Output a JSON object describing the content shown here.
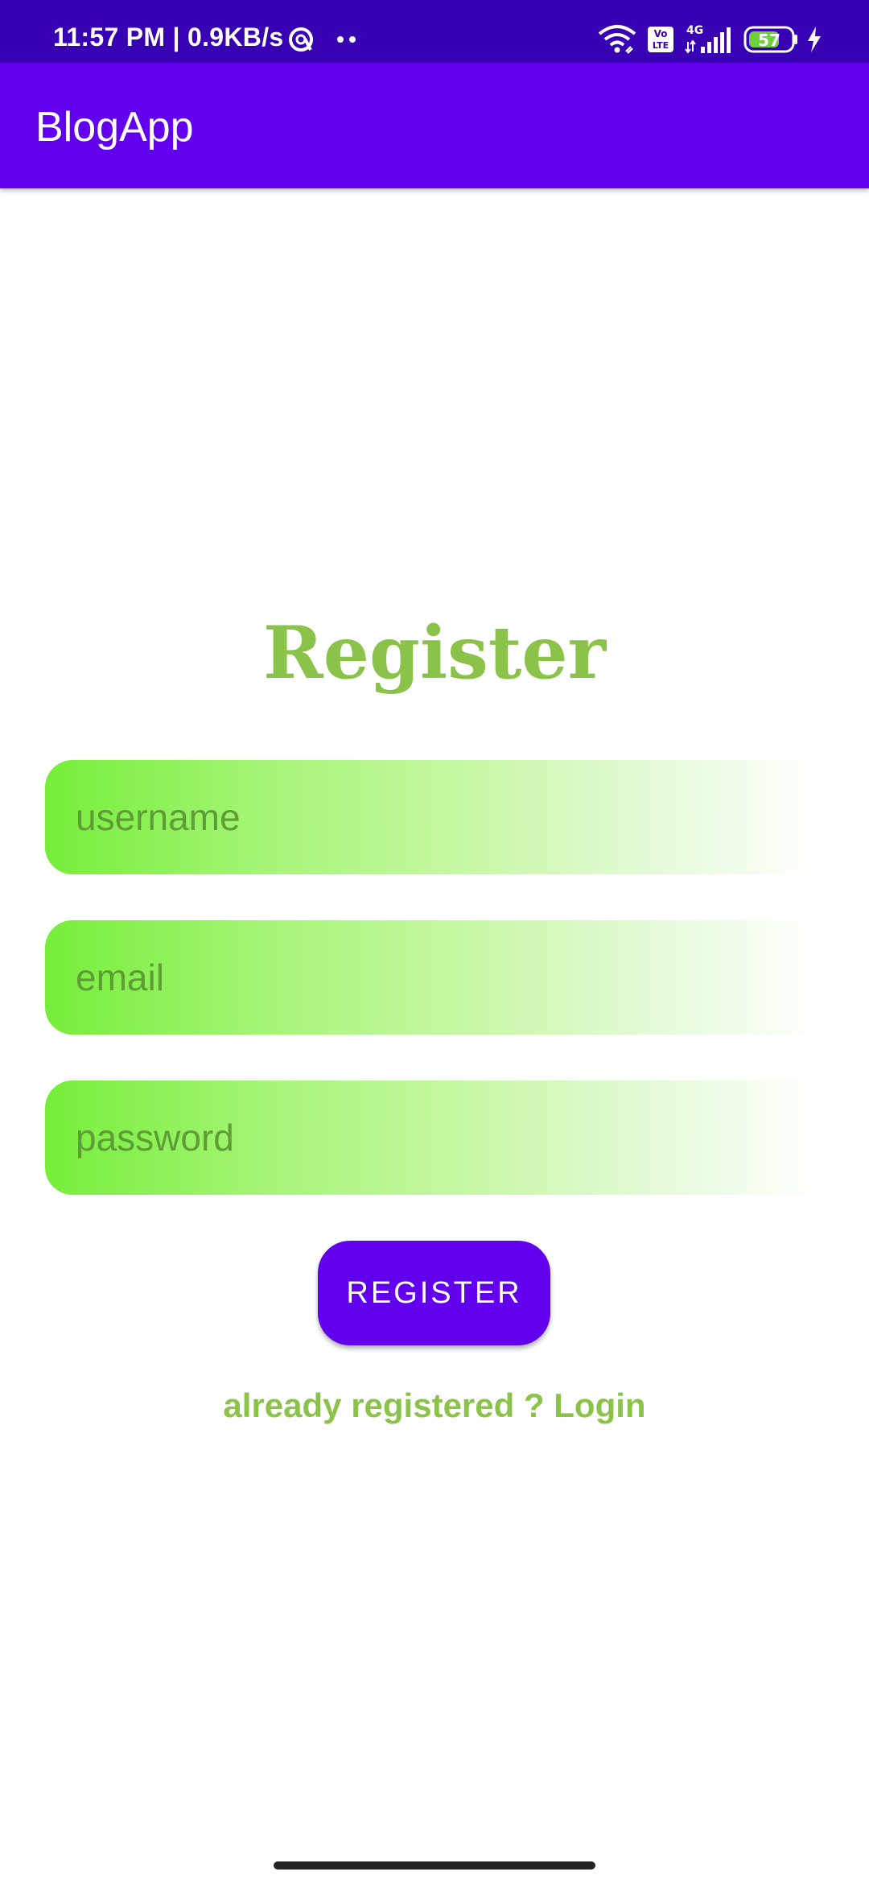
{
  "status_bar": {
    "time": "11:57 PM | 0.9KB/s",
    "network_type": "4G",
    "volte": "Vo LTE",
    "battery": "57",
    "icons": [
      "data-saver-icon",
      "more-dots-icon",
      "wifi-icon",
      "volte-icon",
      "signal-icon",
      "battery-icon",
      "charging-icon"
    ]
  },
  "app_bar": {
    "title": "BlogApp"
  },
  "form": {
    "title": "Register",
    "username_placeholder": "username",
    "email_placeholder": "email",
    "password_placeholder": "password",
    "submit_label": "REGISTER",
    "login_link": "already registered ? Login"
  },
  "colors": {
    "status_bar": "#3700B3",
    "app_bar": "#6200EE",
    "accent_green": "#8BC34A",
    "field_gradient_start": "#76EE3A",
    "button": "#6200EE"
  }
}
